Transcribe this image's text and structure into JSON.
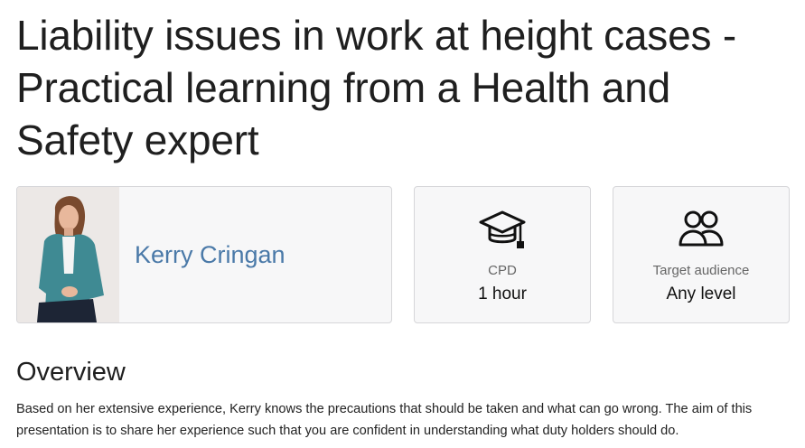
{
  "course": {
    "title": "Liability issues in work at height cases - Practical learning from a Health and Safety expert"
  },
  "speaker": {
    "name": "Kerry Cringan",
    "photo": "speaker-photo"
  },
  "cpd": {
    "icon": "graduation-cap-icon",
    "label": "CPD",
    "value": "1 hour"
  },
  "audience": {
    "icon": "users-icon",
    "label": "Target audience",
    "value": "Any level"
  },
  "overview": {
    "heading": "Overview",
    "text": "Based on her extensive experience, Kerry knows the precautions that should be taken and what can go wrong. The aim of this presentation is to share her experience such that you are confident in understanding what duty holders should do."
  },
  "colors": {
    "link": "#4a79a8",
    "card_bg": "#f7f7f8",
    "card_border": "#d6d6d9"
  }
}
